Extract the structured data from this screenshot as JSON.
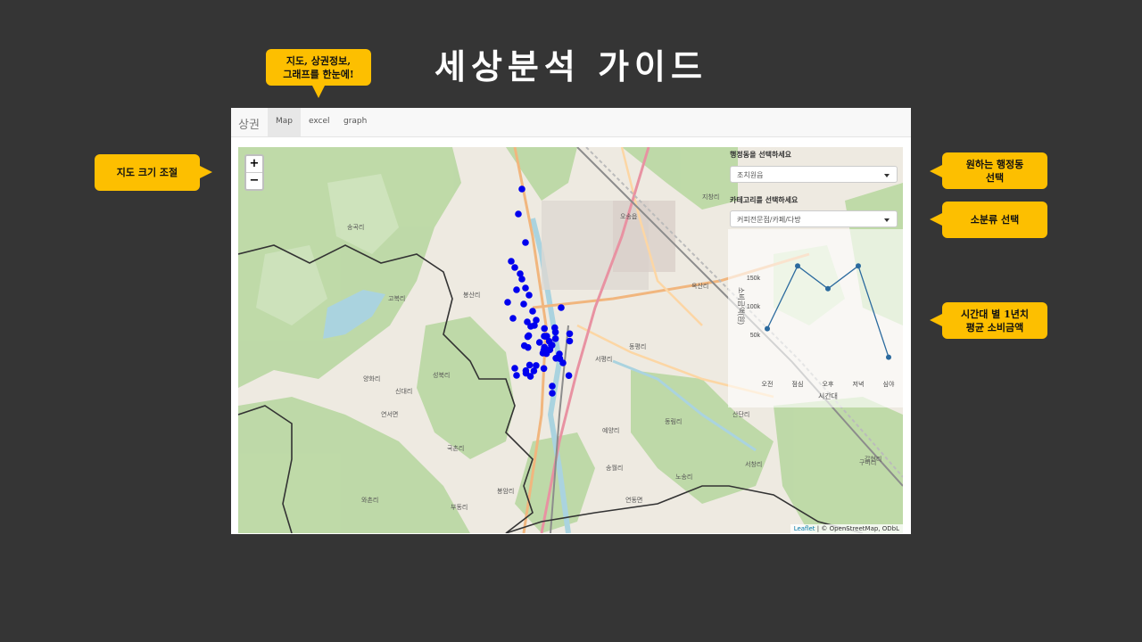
{
  "slide": {
    "title": "세상분석 가이드"
  },
  "callouts": {
    "top": "지도, 상권정보,\n그래프를 한눈에!",
    "left": "지도 크기 조절",
    "right1": "원하는 행정동\n선택",
    "right2": "소분류 선택",
    "right3": "시간대 별 1년치\n평균 소비금액"
  },
  "app": {
    "brand": "상권",
    "tabs": [
      {
        "label": "Map",
        "active": true
      },
      {
        "label": "excel",
        "active": false
      },
      {
        "label": "graph",
        "active": false
      }
    ],
    "zoom": {
      "in": "+",
      "out": "−"
    },
    "filters": {
      "dong_label": "행정동을 선택하세요",
      "dong_value": "조치원읍",
      "category_label": "카테고리를 선택하세요",
      "category_value": "커피전문점/카페/다방"
    },
    "attribution": {
      "leaflet": "Leaflet",
      "rest": " | © OpenStreetMap, ODbL"
    },
    "map_labels": [
      "오송읍",
      "고복리",
      "봉산리",
      "연서면",
      "서평리",
      "동평리",
      "송곡리",
      "양화리",
      "옥산리",
      "신대리",
      "성북리",
      "예양리",
      "국촌리",
      "봉암리",
      "와촌리",
      "부동리",
      "송월리",
      "연동면",
      "노송리",
      "동림리",
      "구미리",
      "갈현리",
      "산단리",
      "서창리",
      "지창리"
    ]
  },
  "chart_data": {
    "type": "line",
    "categories": [
      "오전",
      "점심",
      "오후",
      "저녁",
      "심야"
    ],
    "values": [
      60000,
      170000,
      130000,
      170000,
      10000
    ],
    "xlabel": "시간대",
    "ylabel": "소비금액(원)",
    "yticks": [
      "50k",
      "100k",
      "150k"
    ],
    "ylim": [
      0,
      200000
    ],
    "color": "#2b6a9e"
  },
  "markers": {
    "color": "#0000ee",
    "count": 85
  }
}
